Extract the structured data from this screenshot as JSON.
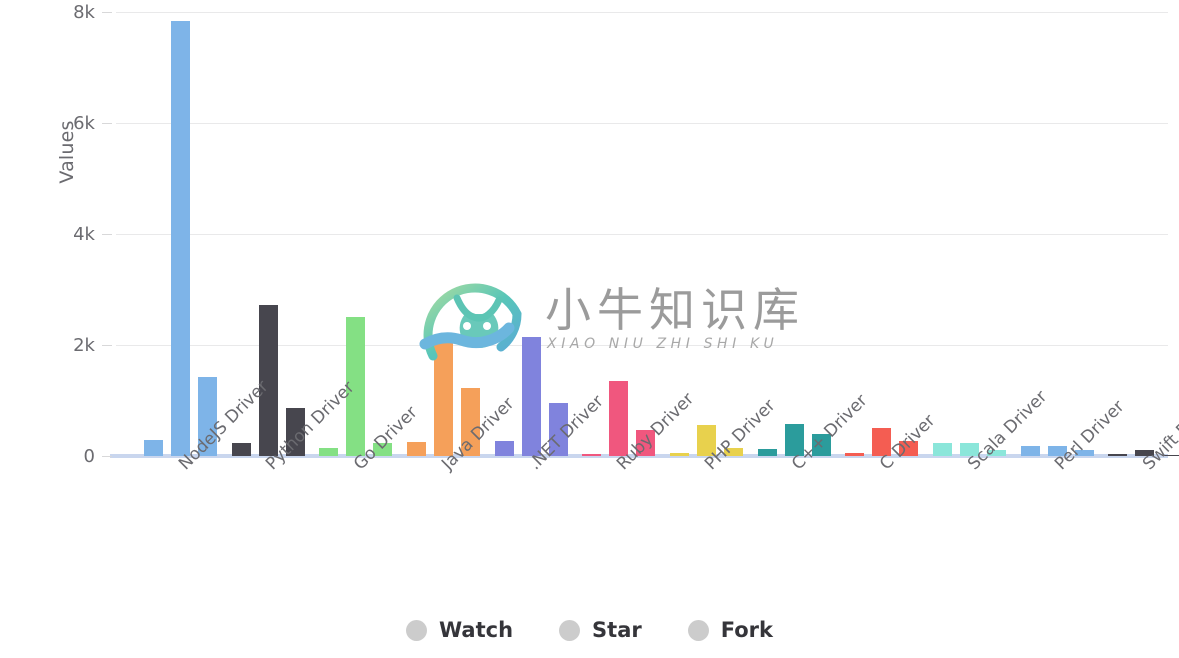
{
  "chart_data": {
    "type": "bar",
    "title": "",
    "xlabel": "",
    "ylabel": "Values",
    "ylim": [
      0,
      8000
    ],
    "yticks": [
      0,
      2000,
      4000,
      6000,
      8000
    ],
    "ytick_labels": [
      "0",
      "2k",
      "4k",
      "6k",
      "8k"
    ],
    "grid": true,
    "legend_position": "bottom",
    "categories": [
      "NodeJS Driver",
      "Python Driver",
      "Go Driver",
      "Java Driver",
      ".NET Driver",
      "Ruby Driver",
      "PHP Driver",
      "C++ Driver",
      "C Driver",
      "Scala Driver",
      "Perl Driver",
      "Swift Driver"
    ],
    "series": [
      {
        "name": "Watch",
        "values": [
          280,
          240,
          140,
          250,
          270,
          40,
          60,
          130,
          60,
          240,
          180,
          30
        ]
      },
      {
        "name": "Star",
        "values": [
          7830,
          2720,
          2500,
          2130,
          2140,
          1350,
          560,
          570,
          500,
          240,
          180,
          110
        ]
      },
      {
        "name": "Fork",
        "values": [
          1430,
          870,
          240,
          1230,
          950,
          460,
          140,
          390,
          270,
          110,
          100,
          20
        ]
      }
    ],
    "group_colors": [
      "#7EB4E8",
      "#47464E",
      "#84E084",
      "#F5A05A",
      "#8083DD",
      "#F0577E",
      "#E8D14D",
      "#2B9C9C",
      "#F45D52",
      "#8BE6DA",
      "#7EB4E8",
      "#47464E"
    ],
    "legend": [
      {
        "label": "Watch",
        "swatch_color": "#cccccc"
      },
      {
        "label": "Star",
        "swatch_color": "#cccccc"
      },
      {
        "label": "Fork",
        "swatch_color": "#cccccc"
      }
    ],
    "watermark": {
      "chinese": "小牛知识库",
      "pinyin": "XIAO NIU ZHI SHI KU"
    }
  }
}
